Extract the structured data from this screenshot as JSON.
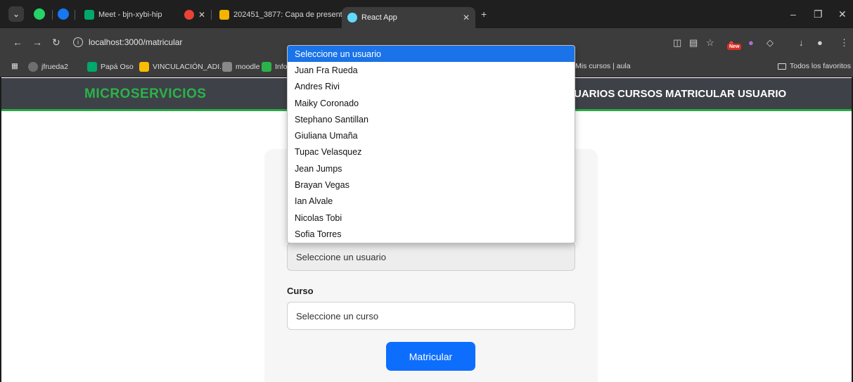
{
  "browser": {
    "tabs": [
      {
        "label": "Meet - bjn-xybi-hip"
      },
      {
        "label": "202451_3877: Capa de presenta"
      },
      {
        "label": "React App"
      }
    ],
    "url": "localhost:3000/matricular",
    "new_badge": "New",
    "bookmarks": [
      {
        "label": "jfrueda2"
      },
      {
        "label": "Papá Oso"
      },
      {
        "label": "VINCULACIÓN_ADI..."
      },
      {
        "label": "moodle"
      },
      {
        "label": "Info"
      },
      {
        "label": "Mis cursos | aula"
      },
      {
        "label": "Todos los favoritos"
      }
    ]
  },
  "header": {
    "brand": "MICROSERVICIOS",
    "nav": [
      {
        "label": "UARIOS"
      },
      {
        "label": "CURSOS"
      },
      {
        "label": "MATRICULAR USUARIO"
      }
    ]
  },
  "form": {
    "usuario_value": "Seleccione un usuario",
    "curso_label": "Curso",
    "curso_value": "Seleccione un curso",
    "submit_label": "Matricular"
  },
  "dropdown": {
    "options": [
      "Seleccione un usuario",
      "Juan Fra Rueda",
      "Andres Rivi",
      "Maiky Coronado",
      "Stephano Santillan",
      "Giuliana Umaña",
      "Tupac Velasquez",
      "Jean Jumps",
      "Brayan Vegas",
      "Ian Alvale",
      "Nicolas Tobi",
      "Sofia Torres"
    ],
    "selected_index": 0
  },
  "colors": {
    "brand_green": "#2bb34a",
    "primary_button": "#0d6efd",
    "header_bg": "#3e4147",
    "selected_option": "#1a73e8"
  }
}
